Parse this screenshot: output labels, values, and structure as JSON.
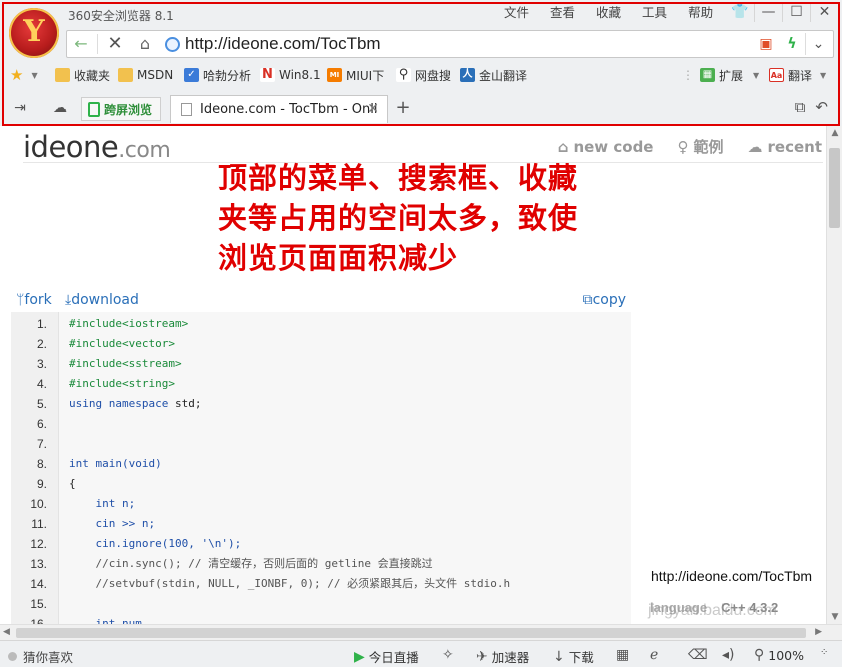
{
  "window": {
    "title": "360安全浏览器 8.1",
    "menu": [
      "文件",
      "查看",
      "收藏",
      "工具",
      "帮助"
    ],
    "controls": [
      "👕",
      "—",
      "☐",
      "✕"
    ]
  },
  "address_bar": {
    "url": "http://ideone.com/TocTbm"
  },
  "bookmarks": [
    {
      "label": "收藏夹",
      "icon": "folder-icon",
      "color": "#f2c14e"
    },
    {
      "label": "MSDN",
      "icon": "folder-icon",
      "color": "#f2c14e"
    },
    {
      "label": "哈勃分析",
      "icon": "shield-icon",
      "color": "#3b7bd8"
    },
    {
      "label": "Win8.1",
      "icon": "win-icon",
      "color": "#d93025"
    },
    {
      "label": "MIUI下",
      "icon": "miui-icon",
      "color": "#f57c00"
    },
    {
      "label": "网盘搜",
      "icon": "search-icon",
      "color": "#333333"
    },
    {
      "label": "金山翻译",
      "icon": "translate-icon",
      "color": "#2a6fb8"
    },
    {
      "label": "扩展",
      "icon": "extensions-icon",
      "color": "#4caf50"
    },
    {
      "label": "翻译",
      "icon": "translate-icon",
      "color": "#d93025"
    }
  ],
  "tabs": {
    "split_view_label": "跨屏浏览",
    "active_title": "Ideone.com - TocTbm - Onli"
  },
  "site": {
    "logo_main": "ideone",
    "logo_tld": ".com",
    "nav": [
      {
        "label": "new code",
        "icon": "home-icon"
      },
      {
        "label": "範例",
        "icon": "lightbulb-icon"
      },
      {
        "label": "recent",
        "icon": "cloud-icon"
      }
    ]
  },
  "annotation": {
    "lines": [
      "顶部的菜单、搜索框、收藏",
      "夹等占用的空间太多，致使",
      "浏览页面面积减少"
    ]
  },
  "code_tools": {
    "fork": "fork",
    "download": "download",
    "copy": "copy"
  },
  "code": [
    {
      "n": "1.",
      "parts": [
        {
          "t": "#include<iostream>",
          "c": "c-green"
        }
      ]
    },
    {
      "n": "2.",
      "parts": [
        {
          "t": "#include<vector>",
          "c": "c-green"
        }
      ]
    },
    {
      "n": "3.",
      "parts": [
        {
          "t": "#include<sstream>",
          "c": "c-green"
        }
      ]
    },
    {
      "n": "4.",
      "parts": [
        {
          "t": "#include<string>",
          "c": "c-green"
        }
      ]
    },
    {
      "n": "5.",
      "parts": [
        {
          "t": "using namespace ",
          "c": "c-blue"
        },
        {
          "t": "std;",
          "c": "c-plain"
        }
      ]
    },
    {
      "n": "6.",
      "parts": []
    },
    {
      "n": "7.",
      "parts": []
    },
    {
      "n": "8.",
      "parts": [
        {
          "t": "int main(void)",
          "c": "c-blue"
        }
      ]
    },
    {
      "n": "9.",
      "parts": [
        {
          "t": "{",
          "c": "c-plain"
        }
      ]
    },
    {
      "n": "10.",
      "parts": [
        {
          "t": "    int n;",
          "c": "c-blue"
        }
      ]
    },
    {
      "n": "11.",
      "parts": [
        {
          "t": "    cin >> n;",
          "c": "c-blue"
        }
      ]
    },
    {
      "n": "12.",
      "parts": [
        {
          "t": "    cin.ignore(100, '\\n');",
          "c": "c-blue"
        }
      ]
    },
    {
      "n": "13.",
      "parts": [
        {
          "t": "    //cin.sync(); // 清空缓存，否则后面的 getline 会直接跳过",
          "c": "c-com"
        }
      ]
    },
    {
      "n": "14.",
      "parts": [
        {
          "t": "    //setvbuf(stdin, NULL, _IONBF, 0); // 必须紧跟其后，头文件 stdio.h",
          "c": "c-com"
        }
      ]
    },
    {
      "n": "15.",
      "parts": []
    },
    {
      "n": "16.",
      "parts": [
        {
          "t": "    int num",
          "c": "c-blue"
        }
      ]
    }
  ],
  "overlay_url": "http://ideone.com/TocTbm",
  "lang_ghost": {
    "label": "language",
    "value": "C++ 4.3.2"
  },
  "status": {
    "left": "猜你喜欢",
    "items": [
      "今日直播",
      "加速器",
      "下载"
    ],
    "zoom": "100%"
  },
  "watermark": "jingyan.baidu.com",
  "colors": {
    "accent": "#e00000",
    "link": "#2a6fb8"
  }
}
